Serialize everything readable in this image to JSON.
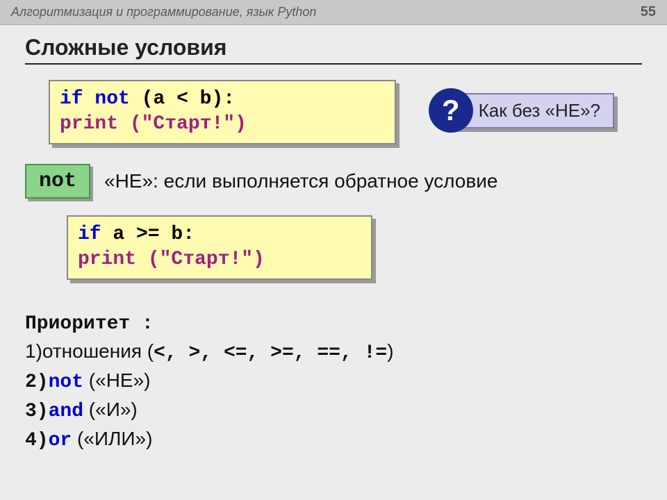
{
  "header": {
    "title": "Алгоритмизация и программирование, язык Python",
    "page": "55"
  },
  "section_title": "Сложные условия",
  "code1": {
    "if": "if",
    "not": "not",
    "expr1": "(a < b):",
    "indent": "   ",
    "print": "print",
    "str": "(\"Старт!\")"
  },
  "callout": {
    "mark": "?",
    "text": "Как без «НЕ»?"
  },
  "not_label": "not",
  "not_desc": "«НЕ»: если выполняется обратное условие",
  "code2": {
    "if": "if",
    "expr1": " a >= b:",
    "indent": "   ",
    "print": "print",
    "str": "(\"Старт!\")"
  },
  "priority": {
    "title": "Приоритет :",
    "l1a": "1)отношения (",
    "l1ops": "<, >, <=, >=, ==, !=",
    "l1b": ")",
    "l2a": "2)",
    "l2kw": "not",
    "l2b": " («НЕ»)",
    "l3a": "3)",
    "l3kw": "and",
    "l3b": " («И»)",
    "l4a": "4)",
    "l4kw": "or",
    "l4b": " («ИЛИ»)"
  }
}
